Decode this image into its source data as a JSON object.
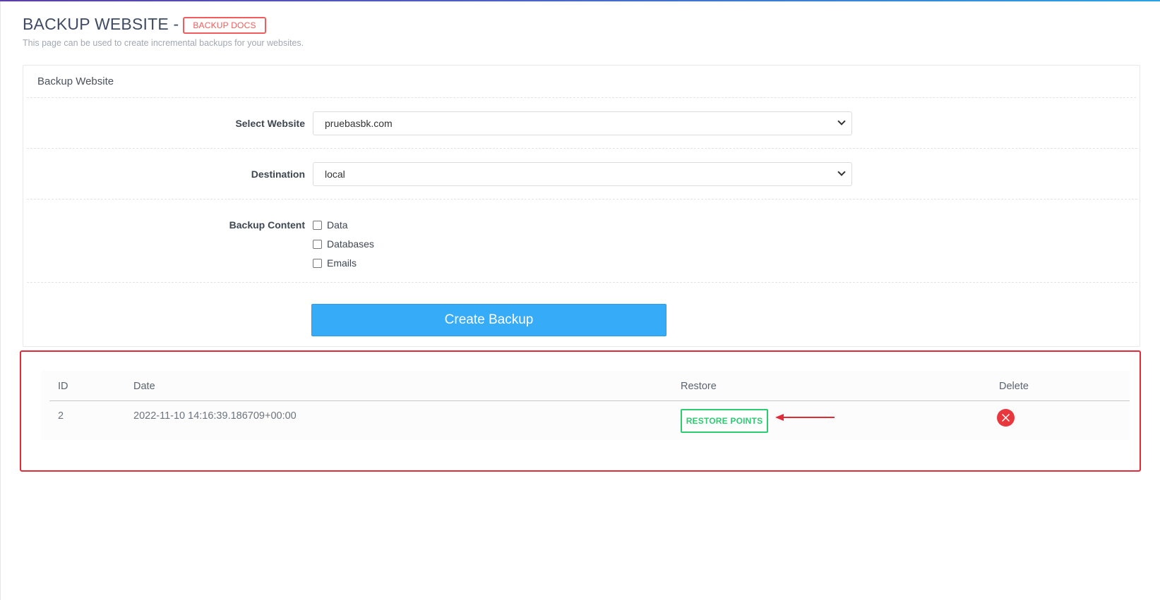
{
  "header": {
    "title": "BACKUP WEBSITE -",
    "docs_label": "BACKUP DOCS",
    "description": "This page can be used to create incremental backups for your websites."
  },
  "panel": {
    "title": "Backup Website",
    "select_website": {
      "label": "Select Website",
      "value": "pruebasbk.com"
    },
    "destination": {
      "label": "Destination",
      "value": "local"
    },
    "backup_content": {
      "label": "Backup Content",
      "options": [
        {
          "label": "Data",
          "checked": false
        },
        {
          "label": "Databases",
          "checked": false
        },
        {
          "label": "Emails",
          "checked": false
        }
      ]
    },
    "create_button": "Create Backup"
  },
  "table": {
    "columns": [
      "ID",
      "Date",
      "Restore",
      "Delete"
    ],
    "rows": [
      {
        "id": "2",
        "date": "2022-11-10 14:16:39.186709+00:00",
        "restore_label": "RESTORE POINTS"
      }
    ]
  },
  "colors": {
    "docs_badge": "#f25c5c",
    "create_button": "#36abf8",
    "restore_button": "#2ecc71",
    "delete_icon": "#e8383d",
    "annotation": "#e32a38"
  },
  "icons": {
    "delete": "close-circle-icon",
    "annotation": "arrow-left-icon"
  }
}
